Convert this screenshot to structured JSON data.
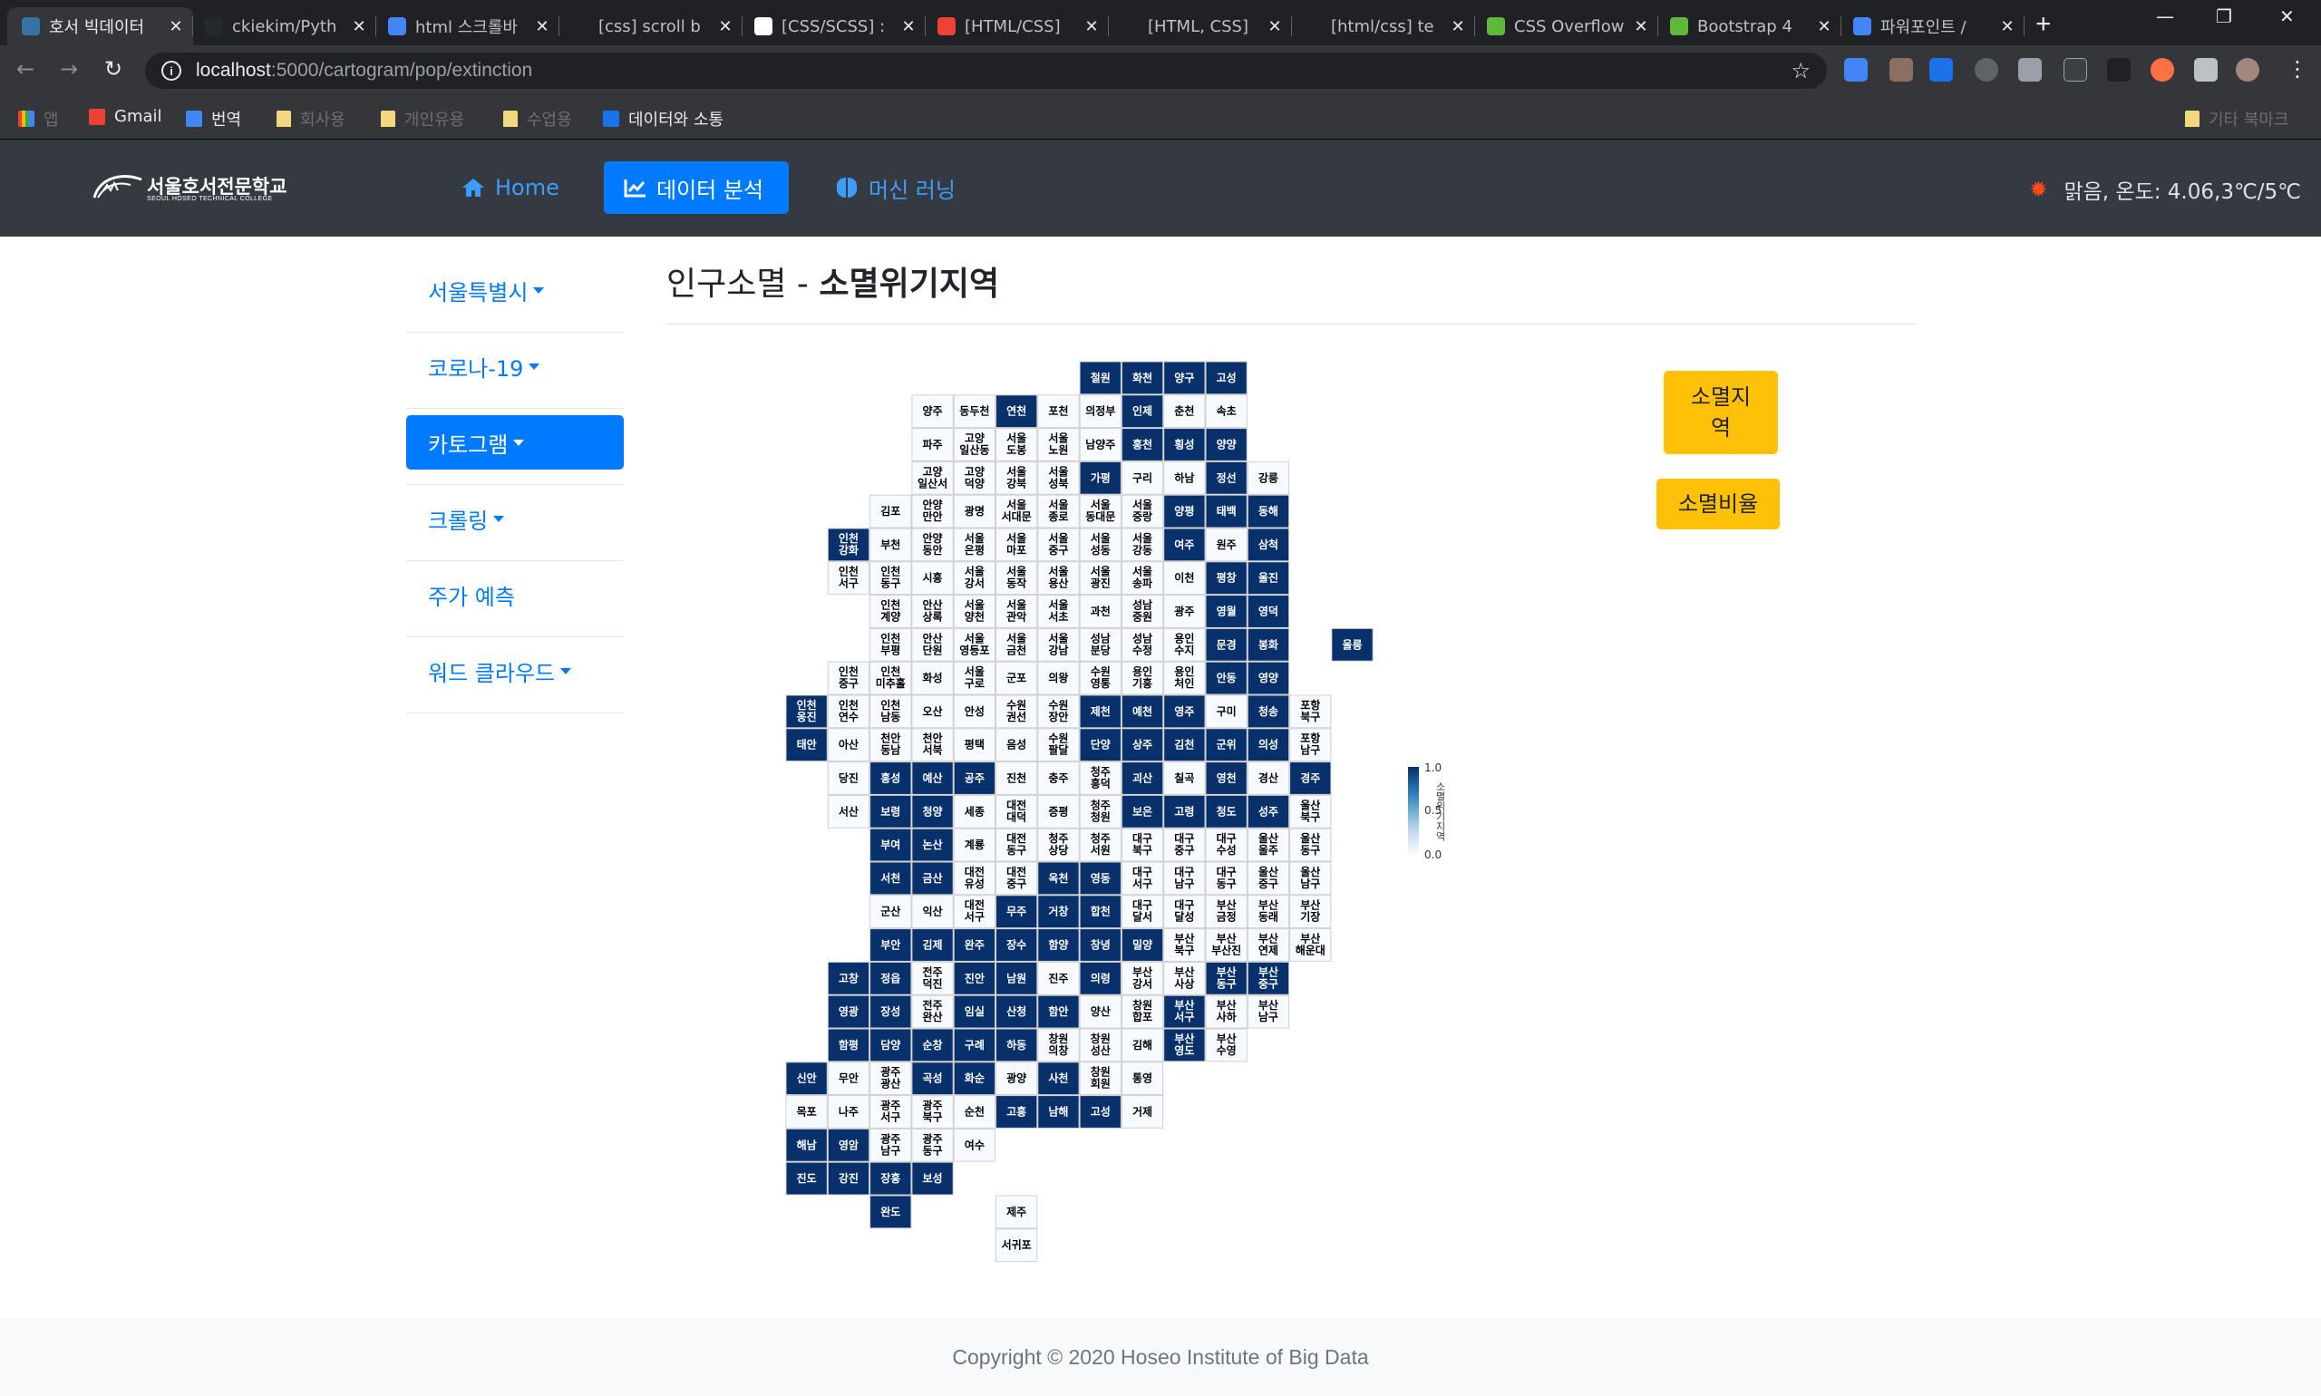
{
  "browser": {
    "tabs": [
      {
        "title": "호서 빅데이터",
        "favicon_color": "#3572A5",
        "favicon_glyph": "py"
      },
      {
        "title": "ckiekim/Pyth",
        "favicon_color": "#24292e",
        "favicon_glyph": "gh"
      },
      {
        "title": "html 스크롤바",
        "favicon_color": "#4285f4",
        "favicon_glyph": "G"
      },
      {
        "title": "[css] scroll b",
        "favicon_color": "#202124",
        "favicon_glyph": ""
      },
      {
        "title": "[CSS/SCSS] :",
        "favicon_color": "#ffffff",
        "favicon_glyph": "⎔"
      },
      {
        "title": "[HTML/CSS]",
        "favicon_color": "#ef4135",
        "favicon_glyph": ""
      },
      {
        "title": "[HTML, CSS]",
        "favicon_color": "#202124",
        "favicon_glyph": ""
      },
      {
        "title": "[html/css] te",
        "favicon_color": "#202124",
        "favicon_glyph": ""
      },
      {
        "title": "CSS Overflow",
        "favicon_color": "#5fb83b",
        "favicon_glyph": "w3"
      },
      {
        "title": "Bootstrap 4",
        "favicon_color": "#5fb83b",
        "favicon_glyph": "w3"
      },
      {
        "title": "파워포인트 /",
        "favicon_color": "#4285f4",
        "favicon_glyph": "G"
      }
    ],
    "url_host": "localhost",
    "url_path": ":5000/cartogram/pop/extinction",
    "bookmarks": [
      {
        "label": "앱",
        "dim": true
      },
      {
        "label": "Gmail",
        "dim": false
      },
      {
        "label": "번역",
        "dim": false
      },
      {
        "label": "회사용",
        "dim": true
      },
      {
        "label": "개인유용",
        "dim": true
      },
      {
        "label": "수업용",
        "dim": true
      },
      {
        "label": "데이터와 소통",
        "dim": false
      },
      {
        "label": "기타 북마크",
        "dim": true
      }
    ]
  },
  "site": {
    "logo_name": "서울호서전문학교",
    "logo_sub": "SEOUL HOSEO TECHNICAL COLLEGE",
    "nav": [
      {
        "label": "Home",
        "icon": "home-icon",
        "active": false
      },
      {
        "label": "데이터 분석",
        "icon": "chart-line-icon",
        "active": true
      },
      {
        "label": "머신 러닝",
        "icon": "brain-icon",
        "active": false
      }
    ],
    "weather": "맑음, 온도: 4.06,3℃/5℃"
  },
  "sidebar": {
    "items": [
      {
        "label": "서울특별시",
        "dropdown": true,
        "active": false
      },
      {
        "label": "코로나-19",
        "dropdown": true,
        "active": false
      },
      {
        "label": "카토그램",
        "dropdown": true,
        "active": true
      },
      {
        "label": "크롤링",
        "dropdown": true,
        "active": false
      },
      {
        "label": "주가 예측",
        "dropdown": false,
        "active": false
      },
      {
        "label": "워드 클라우드",
        "dropdown": true,
        "active": false
      }
    ]
  },
  "main": {
    "title_prefix": "인구소멸 - ",
    "title_main": "소멸위기지역",
    "buttons": {
      "extinction_region": "소멸지\n역",
      "extinction_ratio": "소멸비율"
    }
  },
  "colors": {
    "high": "#08306b",
    "low": "#f7fbff",
    "border": "#222222",
    "navbar": "#343a40",
    "primary": "#007bff",
    "warning": "#ffc107"
  },
  "chart_data": {
    "type": "heatmap",
    "title": "",
    "colorbar": {
      "label": "소멸위기지역",
      "ticks": [
        "1.0",
        "0.5",
        "0.0"
      ],
      "range": [
        0,
        1
      ]
    },
    "rows": [
      {
        "r": 0,
        "c0": 7,
        "cells": [
          "철원:1",
          "화천:1",
          "양구:1",
          "고성:1"
        ]
      },
      {
        "r": 1,
        "c0": 3,
        "cells": [
          "양주:0",
          "동두천:0",
          "연천:1",
          "포천:0",
          "의정부:0",
          "인제:1",
          "춘천:0",
          "속초:0"
        ]
      },
      {
        "r": 2,
        "c0": 3,
        "cells": [
          "파주:0",
          "고양\n일산동:0",
          "서울\n도봉:0",
          "서울\n노원:0",
          "남양주:0",
          "홍천:1",
          "횡성:1",
          "양양:1"
        ]
      },
      {
        "r": 3,
        "c0": 3,
        "cells": [
          "고양\n일산서:0",
          "고양\n덕양:0",
          "서울\n강북:0",
          "서울\n성북:0",
          "가평:1",
          "구리:0",
          "하남:0",
          "정선:1",
          "강릉:0"
        ]
      },
      {
        "r": 4,
        "c0": 2,
        "cells": [
          "김포:0",
          "안양\n만안:0",
          "광명:0",
          "서울\n서대문:0",
          "서울\n종로:0",
          "서울\n동대문:0",
          "서울\n중랑:0",
          "양평:1",
          "태백:1",
          "동해:1"
        ]
      },
      {
        "r": 5,
        "c0": 1,
        "cells": [
          "인천\n강화:1",
          "부천:0",
          "안양\n동안:0",
          "서울\n은평:0",
          "서울\n마포:0",
          "서울\n중구:0",
          "서울\n성동:0",
          "서울\n강동:0",
          "여주:1",
          "원주:0",
          "삼척:1"
        ]
      },
      {
        "r": 6,
        "c0": 1,
        "cells": [
          "인천\n서구:0",
          "인천\n동구:0",
          "시흥:0",
          "서울\n강서:0",
          "서울\n동작:0",
          "서울\n용산:0",
          "서울\n광진:0",
          "서울\n송파:0",
          "이천:0",
          "평창:1",
          "울진:1"
        ]
      },
      {
        "r": 7,
        "c0": 2,
        "cells": [
          "인천\n계양:0",
          "안산\n상록:0",
          "서울\n양천:0",
          "서울\n관악:0",
          "서울\n서초:0",
          "과천:0",
          "성남\n중원:0",
          "광주:0",
          "영월:1",
          "영덕:1"
        ]
      },
      {
        "r": 8,
        "c0": 2,
        "cells": [
          "인천\n부평:0",
          "안산\n단원:0",
          "서울\n영등포:0",
          "서울\n금천:0",
          "서울\n강남:0",
          "성남\n분당:0",
          "성남\n수정:0",
          "용인\n수지:0",
          "문경:1",
          "봉화:1"
        ],
        "extra": [
          {
            "c": 13,
            "t": "울릉:1"
          }
        ]
      },
      {
        "r": 9,
        "c0": 1,
        "cells": [
          "인천\n중구:0",
          "인천\n미추홀:0",
          "화성:0",
          "서울\n구로:0",
          "군포:0",
          "의왕:0",
          "수원\n영통:0",
          "용인\n기흥:0",
          "용인\n처인:0",
          "안동:1",
          "영양:1"
        ]
      },
      {
        "r": 10,
        "c0": 0,
        "cells": [
          "인천\n옹진:1",
          "인천\n연수:0",
          "인천\n남동:0",
          "오산:0",
          "안성:0",
          "수원\n권선:0",
          "수원\n장안:0",
          "제천:1",
          "예천:1",
          "영주:1",
          "구미:0",
          "청송:1",
          "포항\n북구:0"
        ]
      },
      {
        "r": 11,
        "c0": 0,
        "cells": [
          "태안:1",
          "아산:0",
          "천안\n동남:0",
          "천안\n서북:0",
          "평택:0",
          "음성:0",
          "수원\n팔달:0",
          "단양:1",
          "상주:1",
          "김천:1",
          "군위:1",
          "의성:1",
          "포항\n남구:0"
        ]
      },
      {
        "r": 12,
        "c0": 1,
        "cells": [
          "당진:0",
          "홍성:1",
          "예산:1",
          "공주:1",
          "진천:0",
          "충주:0",
          "청주\n흥덕:0",
          "괴산:1",
          "칠곡:0",
          "영천:1",
          "경산:0",
          "경주:1"
        ]
      },
      {
        "r": 13,
        "c0": 1,
        "cells": [
          "서산:0",
          "보령:1",
          "청양:1",
          "세종:0",
          "대전\n대덕:0",
          "증평:0",
          "청주\n청원:0",
          "보은:1",
          "고령:1",
          "청도:1",
          "성주:1",
          "울산\n북구:0"
        ]
      },
      {
        "r": 14,
        "c0": 2,
        "cells": [
          "부여:1",
          "논산:1",
          "계룡:0",
          "대전\n동구:0",
          "청주\n상당:0",
          "청주\n서원:0",
          "대구\n북구:0",
          "대구\n중구:0",
          "대구\n수성:0",
          "울산\n울주:0",
          "울산\n동구:0"
        ]
      },
      {
        "r": 15,
        "c0": 2,
        "cells": [
          "서천:1",
          "금산:1",
          "대전\n유성:0",
          "대전\n중구:0",
          "옥천:1",
          "영동:1",
          "대구\n서구:0",
          "대구\n남구:0",
          "대구\n동구:0",
          "울산\n중구:0",
          "울산\n남구:0"
        ]
      },
      {
        "r": 16,
        "c0": 2,
        "cells": [
          "군산:0",
          "익산:0",
          "대전\n서구:0",
          "무주:1",
          "거창:1",
          "합천:1",
          "대구\n달서:0",
          "대구\n달성:0",
          "부산\n금정:0",
          "부산\n동래:0",
          "부산\n기장:0"
        ]
      },
      {
        "r": 17,
        "c0": 2,
        "cells": [
          "부안:1",
          "김제:1",
          "완주:1",
          "장수:1",
          "함양:1",
          "창녕:1",
          "밀양:1",
          "부산\n북구:0",
          "부산\n부산진:0",
          "부산\n연제:0",
          "부산\n해운대:0"
        ]
      },
      {
        "r": 18,
        "c0": 1,
        "cells": [
          "고창:1",
          "정읍:1",
          "전주\n덕진:0",
          "진안:1",
          "남원:1",
          "진주:0",
          "의령:1",
          "부산\n강서:0",
          "부산\n사상:0",
          "부산\n동구:1",
          "부산\n중구:1"
        ]
      },
      {
        "r": 19,
        "c0": 1,
        "cells": [
          "영광:1",
          "장성:1",
          "전주\n완산:0",
          "임실:1",
          "산청:1",
          "함안:1",
          "양산:0",
          "창원\n합포:0",
          "부산\n서구:1",
          "부산\n사하:0",
          "부산\n남구:0"
        ]
      },
      {
        "r": 20,
        "c0": 1,
        "cells": [
          "함평:1",
          "담양:1",
          "순창:1",
          "구례:1",
          "하동:1",
          "창원\n의창:0",
          "창원\n성산:0",
          "김해:0",
          "부산\n영도:1",
          "부산\n수영:0"
        ]
      },
      {
        "r": 21,
        "c0": 0,
        "cells": [
          "신안:1",
          "무안:0",
          "광주\n광산:0",
          "곡성:1",
          "화순:1",
          "광양:0",
          "사천:1",
          "창원\n회원:0",
          "통영:0"
        ]
      },
      {
        "r": 22,
        "c0": 0,
        "cells": [
          "목포:0",
          "나주:0",
          "광주\n서구:0",
          "광주\n북구:0",
          "순천:0",
          "고흥:1",
          "남해:1",
          "고성:1",
          "거제:0"
        ]
      },
      {
        "r": 23,
        "c0": 0,
        "cells": [
          "해남:1",
          "영암:1",
          "광주\n남구:0",
          "광주\n동구:0",
          "여수:0"
        ]
      },
      {
        "r": 24,
        "c0": 0,
        "cells": [
          "진도:1",
          "강진:1",
          "장흥:1",
          "보성:1"
        ]
      },
      {
        "r": 25,
        "c0": 2,
        "cells": [
          "완도:1"
        ],
        "extra": [
          {
            "c": 5,
            "t": "제주:0"
          }
        ]
      },
      {
        "r": 26,
        "c0": 5,
        "cells": [
          "서귀포:0"
        ]
      }
    ]
  }
}
